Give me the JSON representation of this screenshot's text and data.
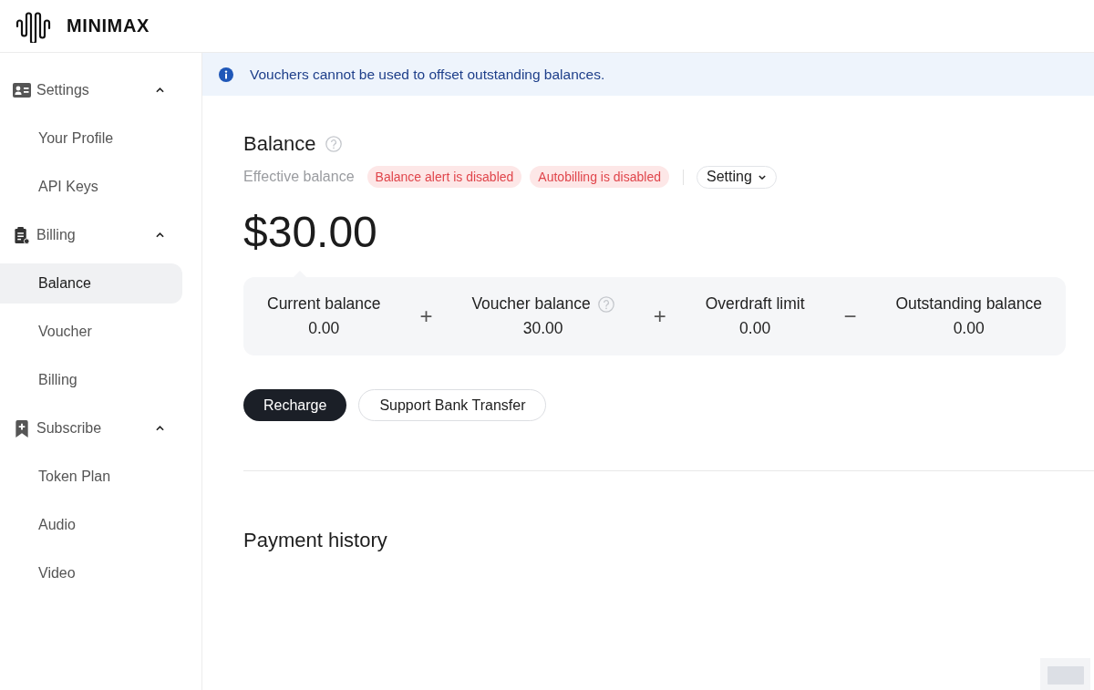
{
  "logo": {
    "text": "MINIMAX"
  },
  "sidebar": {
    "groups": [
      {
        "label": "Settings",
        "expanded": true,
        "items": [
          {
            "label": "Your Profile",
            "selected": false
          },
          {
            "label": "API Keys",
            "selected": false
          }
        ]
      },
      {
        "label": "Billing",
        "expanded": true,
        "items": [
          {
            "label": "Balance",
            "selected": true
          },
          {
            "label": "Voucher",
            "selected": false
          },
          {
            "label": "Billing",
            "selected": false
          }
        ]
      },
      {
        "label": "Subscribe",
        "expanded": true,
        "items": [
          {
            "label": "Token Plan",
            "selected": false
          },
          {
            "label": "Audio",
            "selected": false
          },
          {
            "label": "Video",
            "selected": false
          }
        ]
      }
    ]
  },
  "notice": {
    "text": "Vouchers cannot be used to offset outstanding balances."
  },
  "balance": {
    "title": "Balance",
    "subtitle": "Effective balance",
    "badges": [
      "Balance alert is disabled",
      "Autobilling is disabled"
    ],
    "setting_button": "Setting",
    "amount": "$30.00",
    "breakdown": [
      {
        "label": "Current balance",
        "value": "0.00",
        "help": false
      },
      {
        "label": "Voucher balance",
        "value": "30.00",
        "help": true
      },
      {
        "label": "Overdraft limit",
        "value": "0.00",
        "help": false
      },
      {
        "label": "Outstanding balance",
        "value": "0.00",
        "help": false
      }
    ],
    "operators": [
      "+",
      "+",
      "−"
    ],
    "actions": [
      {
        "label": "Recharge",
        "kind": "primary"
      },
      {
        "label": "Support Bank Transfer",
        "kind": "secondary"
      }
    ]
  },
  "payment_history": {
    "title": "Payment history"
  }
}
